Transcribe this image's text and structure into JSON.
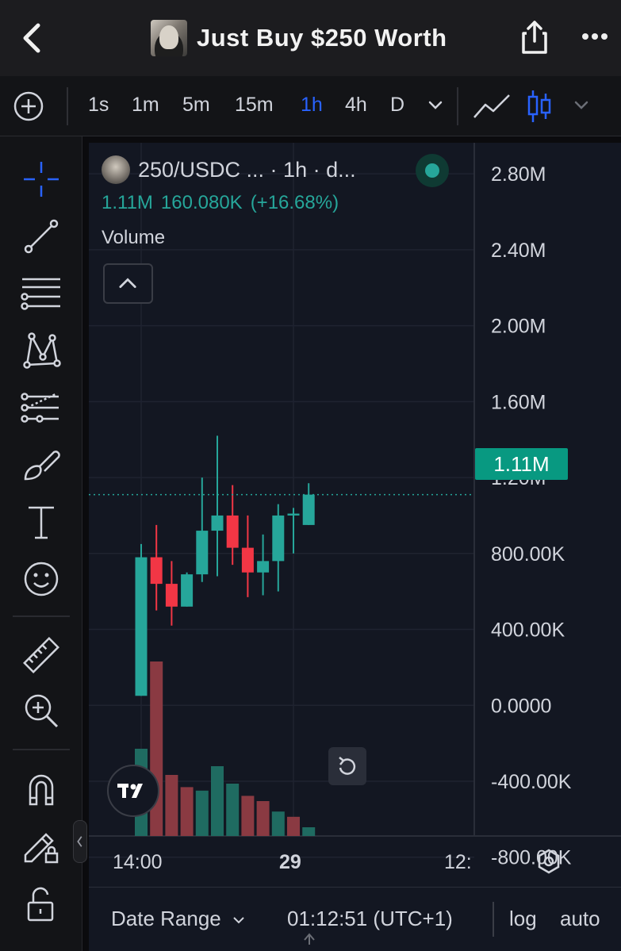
{
  "header": {
    "title": "Just Buy $250 Worth"
  },
  "toolbar": {
    "timeframes": [
      "1s",
      "1m",
      "5m",
      "15m",
      "1h",
      "4h",
      "D"
    ],
    "active_timeframe": "1h",
    "accent_color": "#2962ff"
  },
  "legend": {
    "symbol": "250/USDC ... · 1h · d...",
    "last_value": "1.11M",
    "change_value": "160.080K",
    "change_pct": "(+16.68%)",
    "volume_label": "Volume"
  },
  "price_axis": {
    "labels": [
      "2.80M",
      "2.40M",
      "2.00M",
      "1.60M",
      "1.20M",
      "800.00K",
      "400.00K",
      "0.0000",
      "-400.00K",
      "-800.00K"
    ],
    "current_price_label": "1.11M"
  },
  "time_axis": {
    "labels": [
      "14:00",
      "29",
      "12:"
    ]
  },
  "bottom_bar": {
    "date_range_label": "Date Range",
    "clock": "01:12:51 (UTC+1)",
    "log_label": "log",
    "auto_label": "auto"
  },
  "colors": {
    "up": "#26a69a",
    "down": "#f23645",
    "up_volume": "#1f6b61",
    "down_volume": "#8a3a42",
    "background": "#131722"
  },
  "chart_data": {
    "type": "candlestick",
    "ylim": [
      -960000,
      2880000
    ],
    "current_price": 1110000,
    "candles": [
      {
        "open": 50000,
        "high": 850000,
        "low": 50000,
        "close": 780000
      },
      {
        "open": 780000,
        "high": 950000,
        "low": 500000,
        "close": 640000
      },
      {
        "open": 640000,
        "high": 760000,
        "low": 420000,
        "close": 520000
      },
      {
        "open": 520000,
        "high": 700000,
        "low": 520000,
        "close": 690000
      },
      {
        "open": 690000,
        "high": 1200000,
        "low": 650000,
        "close": 920000
      },
      {
        "open": 920000,
        "high": 1420000,
        "low": 680000,
        "close": 1000000
      },
      {
        "open": 1000000,
        "high": 1160000,
        "low": 740000,
        "close": 830000
      },
      {
        "open": 830000,
        "high": 1000000,
        "low": 570000,
        "close": 700000
      },
      {
        "open": 700000,
        "high": 900000,
        "low": 580000,
        "close": 760000
      },
      {
        "open": 760000,
        "high": 1060000,
        "low": 600000,
        "close": 1000000
      },
      {
        "open": 1000000,
        "high": 1040000,
        "low": 800000,
        "close": 1010000
      },
      {
        "open": 950000,
        "high": 1170000,
        "low": 950000,
        "close": 1110000
      }
    ],
    "volume": [
      {
        "value": 0.5,
        "up": true
      },
      {
        "value": 1.0,
        "up": false
      },
      {
        "value": 0.35,
        "up": false
      },
      {
        "value": 0.28,
        "up": false
      },
      {
        "value": 0.26,
        "up": true
      },
      {
        "value": 0.4,
        "up": true
      },
      {
        "value": 0.3,
        "up": true
      },
      {
        "value": 0.23,
        "up": false
      },
      {
        "value": 0.2,
        "up": false
      },
      {
        "value": 0.14,
        "up": true
      },
      {
        "value": 0.11,
        "up": false
      },
      {
        "value": 0.05,
        "up": true
      }
    ]
  }
}
